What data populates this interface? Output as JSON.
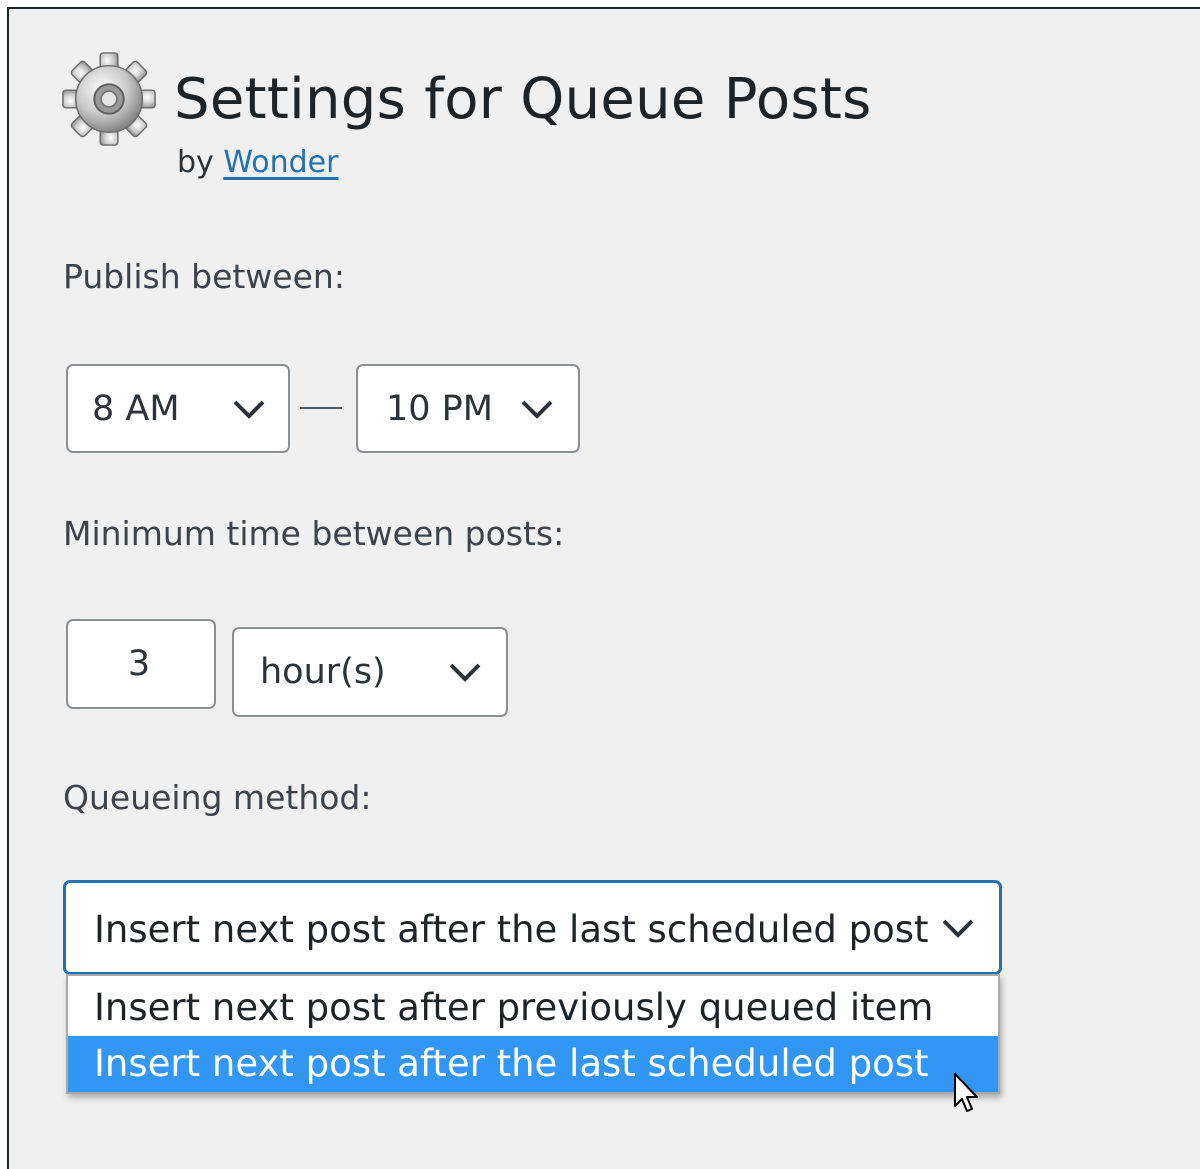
{
  "header": {
    "title": "Settings for Queue Posts",
    "by_prefix": "by",
    "author": "Wonder"
  },
  "publish": {
    "label": "Publish between:",
    "start": "8 AM",
    "end": "10 PM"
  },
  "interval": {
    "label": "Minimum time between posts:",
    "value": "3",
    "unit": "hour(s)"
  },
  "queueing": {
    "label": "Queueing method:",
    "selected": "Insert next post after the last scheduled post",
    "options": [
      "Insert next post after previously queued item",
      "Insert next post after the last scheduled post"
    ],
    "highlighted_index": 1
  },
  "icons": {
    "header": "gear-icon",
    "dropdown": "chevron-down-icon",
    "pointer": "mouse-cursor-icon"
  },
  "colors": {
    "link": "#2271b1",
    "focus_border": "#2271b1",
    "option_highlight": "#3296f5",
    "background": "#f0f0f1"
  }
}
